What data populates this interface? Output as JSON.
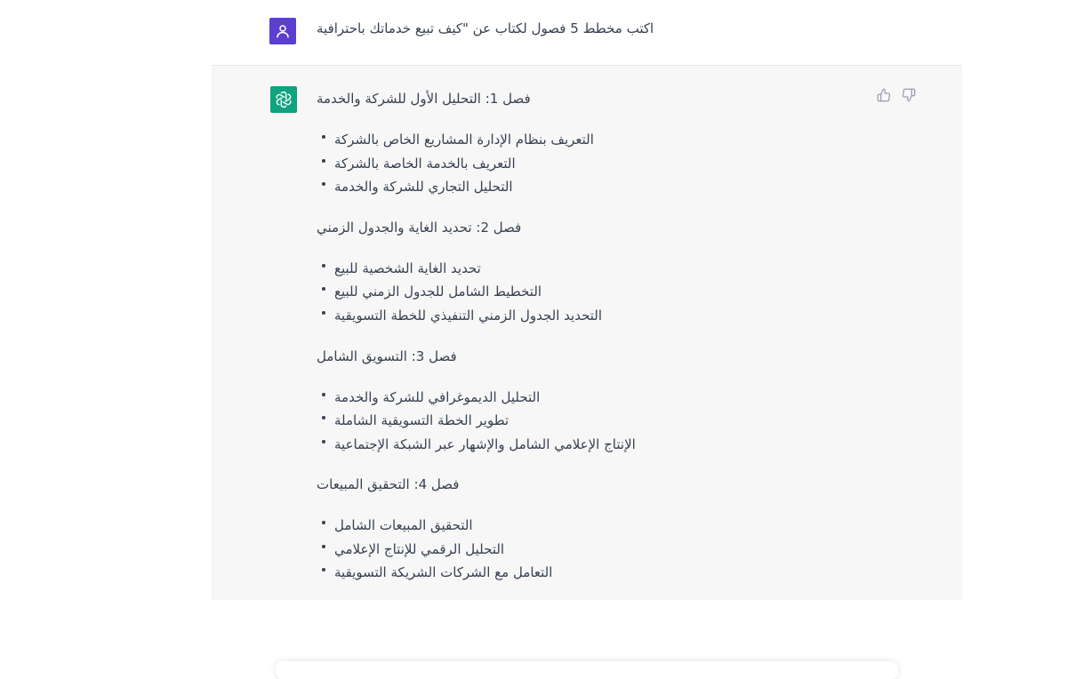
{
  "user_message": "اكتب مخطط 5 فصول لكتاب عن \"كيف تبيع خدماتك باحترافية",
  "chapters": [
    {
      "title": "فصل 1: التحليل الأول للشركة والخدمة",
      "items": [
        "التعريف بنظام الإدارة المشاريع الخاص بالشركة",
        "التعريف بالخدمة الخاصة بالشركة",
        "التحليل التجاري للشركة والخدمة"
      ]
    },
    {
      "title": "فصل 2: تحديد الغاية والجدول الزمني",
      "items": [
        "تحديد الغاية الشخصية للبيع",
        "التخطيط الشامل للجدول الزمني للبيع",
        "التحديد الجدول الزمني التنفيذي للخطة التسويقية"
      ]
    },
    {
      "title": "فصل 3: التسويق الشامل",
      "items": [
        "التحليل الديموغرافي للشركة والخدمة",
        "تطوير الخطة التسويقية الشاملة",
        "الإنتاج الإعلامي الشامل والإشهار عبر الشبكة الإجتماعية"
      ]
    },
    {
      "title": "فصل 4: التحقيق المبيعات",
      "items": [
        "التحقيق المبيعات الشامل",
        "التحليل الرقمي للإنتاج الإعلامي",
        "التعامل مع الشركات الشريكة التسويقية"
      ]
    }
  ],
  "icons": {
    "user": "user-icon",
    "assistant": "openai-logo-icon",
    "like": "thumbs-up-icon",
    "dislike": "thumbs-down-icon"
  },
  "colors": {
    "user_avatar": "#5b3fd1",
    "assistant_avatar": "#10a37f",
    "assistant_bg": "#f7f7f8"
  }
}
